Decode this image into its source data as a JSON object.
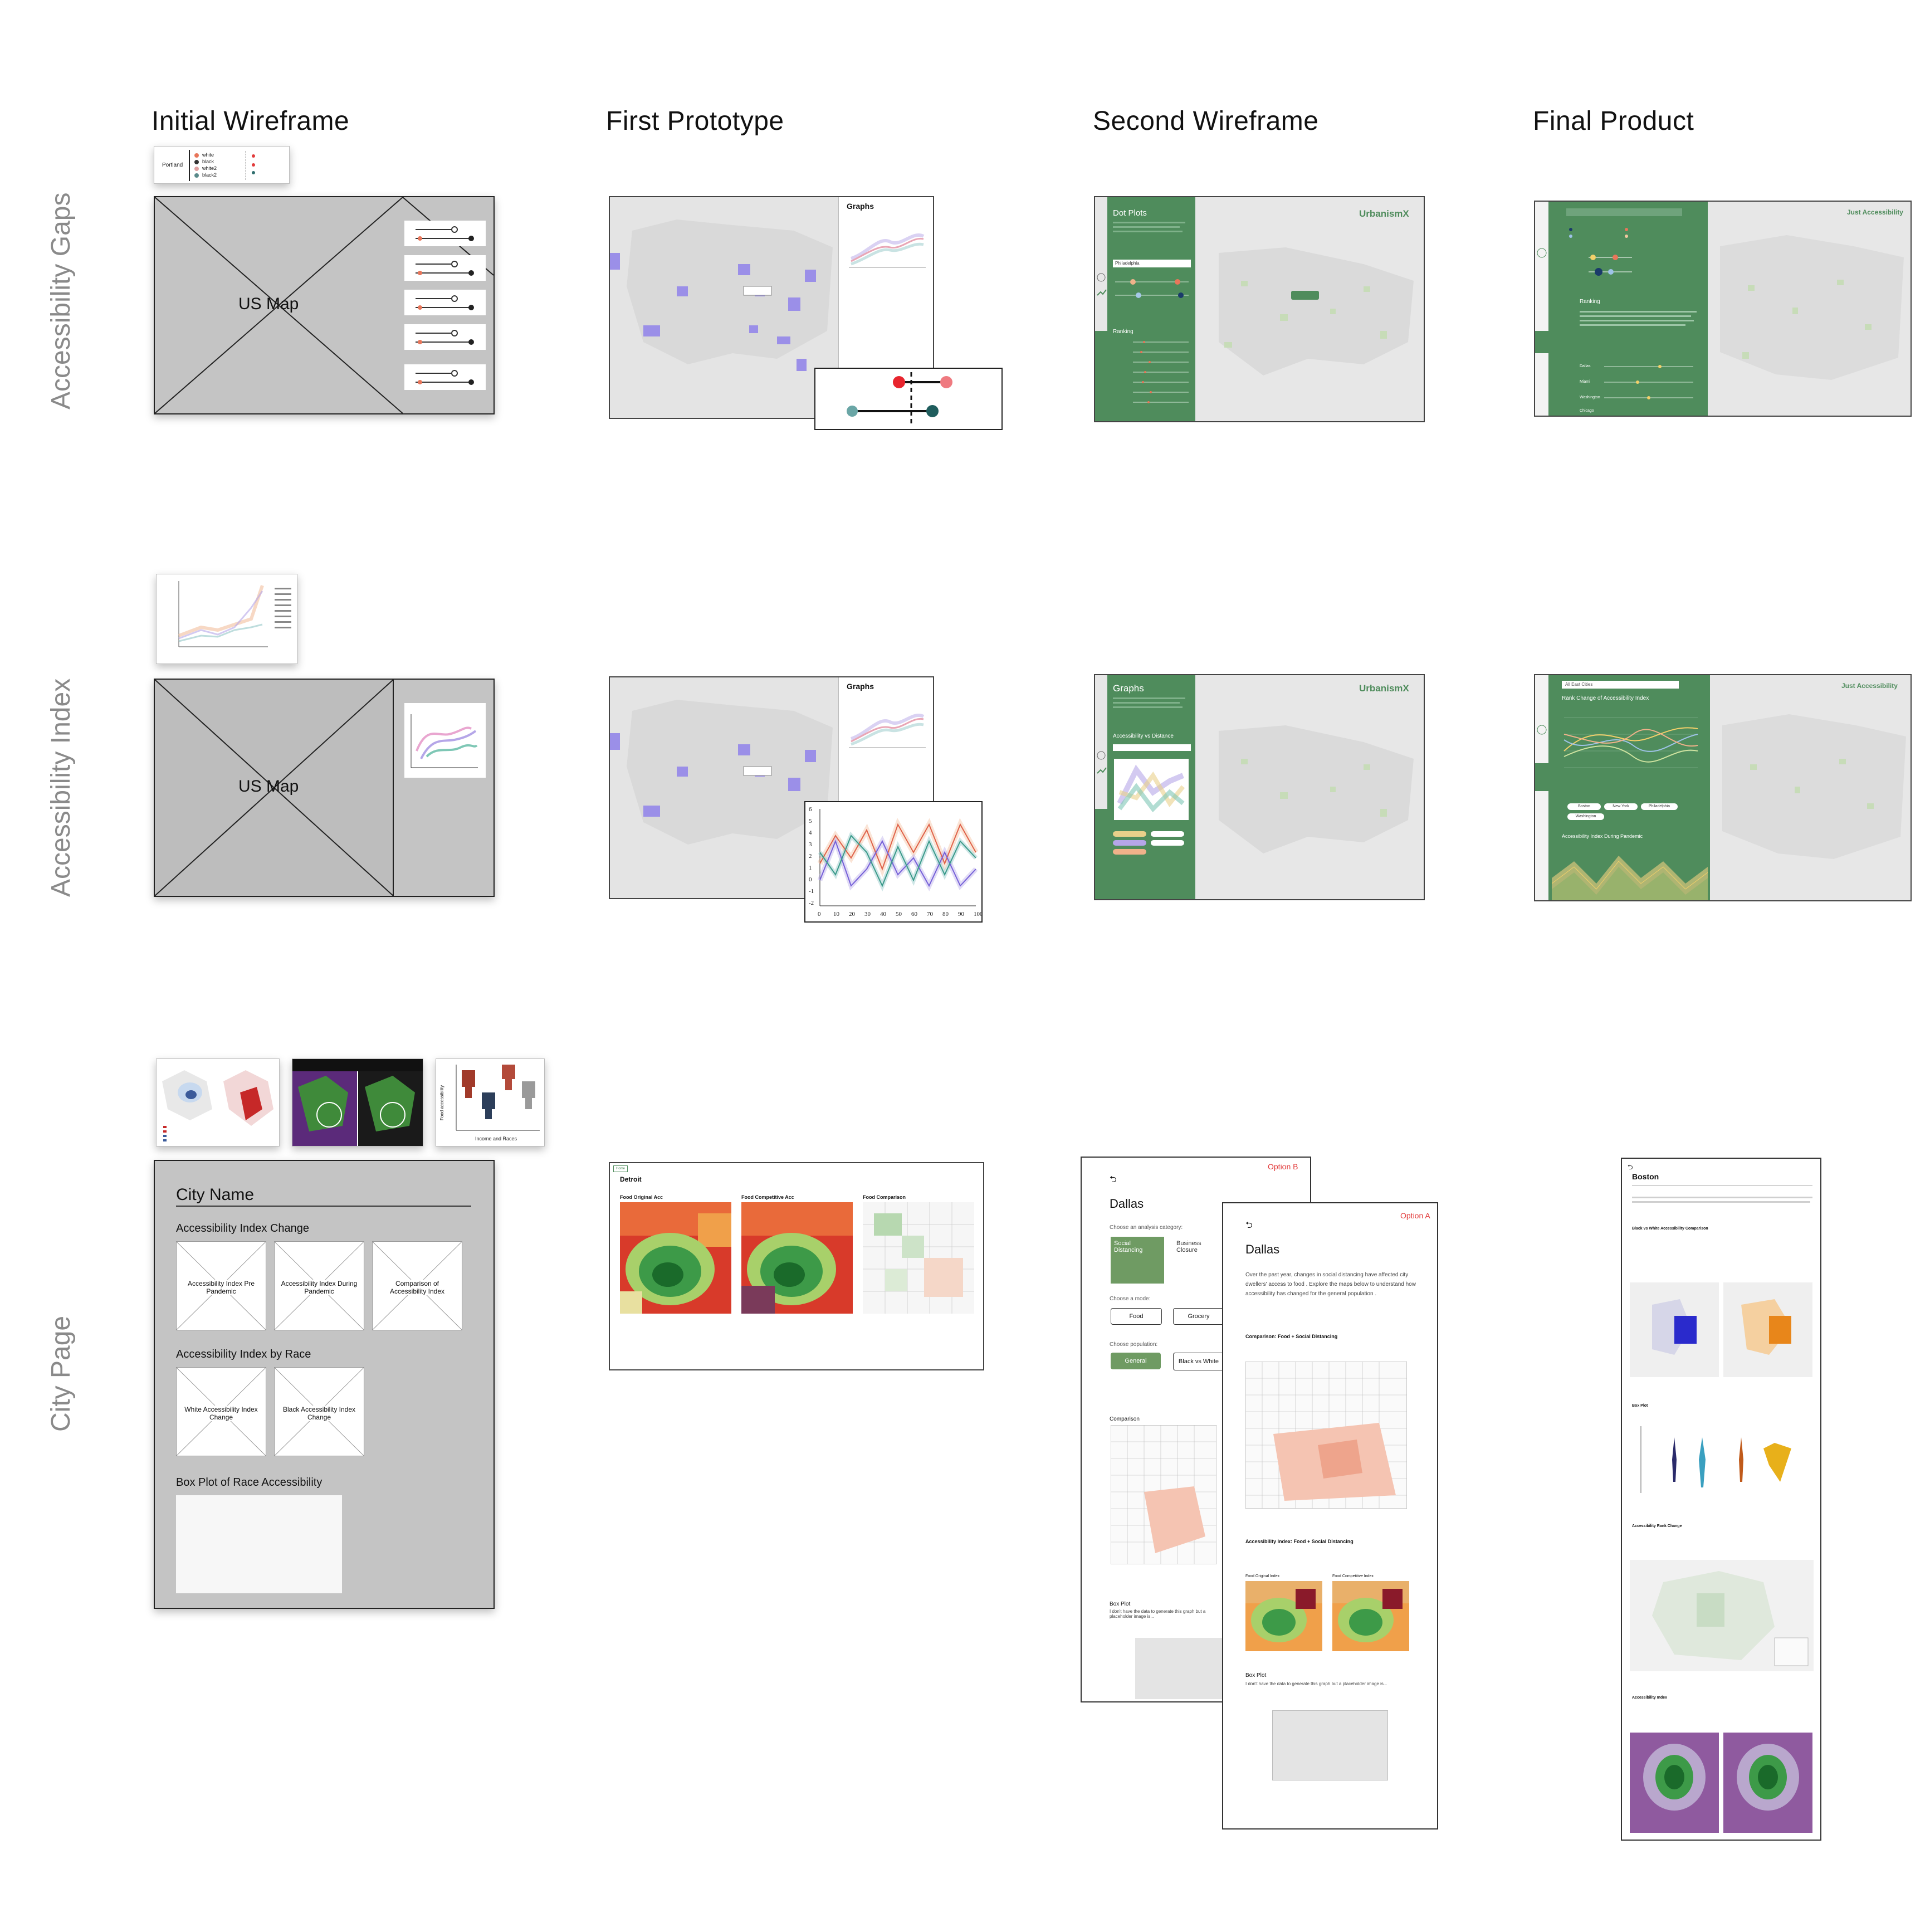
{
  "columns": [
    "Initial Wireframe",
    "First Prototype",
    "Second Wireframe",
    "Final Product"
  ],
  "rows": [
    "Accessibility Gaps",
    "Accessibility Index",
    "City Page"
  ],
  "colors": {
    "green_panel": "#4f8c5c",
    "wire_gray": "#c4c4c4",
    "accent_red": "#e23b3b",
    "accent_teal": "#2f6e6e",
    "map_gray": "#e7e7e7"
  },
  "gaps": {
    "wireframe": {
      "map_label": "US Map",
      "legend_city": "Portland",
      "legend_items": [
        "white",
        "black",
        "white2",
        "black2"
      ]
    },
    "prototype": {
      "panel_title": "Graphs"
    },
    "second": {
      "panel_title": "Dot Plots",
      "brand": "UrbanismX",
      "city_select": "Philadelphia",
      "ranking_label": "Ranking"
    },
    "final": {
      "brand": "Just Accessibility",
      "ranking_label": "Ranking",
      "cities": [
        "Dallas",
        "Miami",
        "Washington",
        "Chicago"
      ]
    }
  },
  "index": {
    "wireframe": {
      "map_label": "US Map"
    },
    "prototype": {
      "panel_title": "Graphs",
      "x_ticks": [
        "0",
        "10",
        "20",
        "30",
        "40",
        "50",
        "60",
        "70",
        "80",
        "90",
        "100"
      ],
      "y_ticks": [
        "6",
        "5",
        "4",
        "3",
        "2",
        "1",
        "0",
        "-1",
        "-2"
      ]
    },
    "second": {
      "panel_title": "Graphs",
      "brand": "UrbanismX",
      "chart_label": "Accessibility vs Distance"
    },
    "final": {
      "brand": "Just Accessibility",
      "select": "All East Cities",
      "chart_title": "Rank Change of Accessibility Index",
      "chart2_title": "Accessibility Index During Pandemic",
      "legend": [
        "Boston",
        "New York",
        "Philadelphia",
        "Washington"
      ]
    }
  },
  "city": {
    "wireframe": {
      "title": "City Name",
      "section1": "Accessibility Index Change",
      "cards1": [
        "Accessibility Index Pre Pandemic",
        "Accessibility Index During Pandemic",
        "Comparison of Accessibility Index"
      ],
      "section2": "Accessibility Index by Race",
      "cards2": [
        "White Accessibility Index Change",
        "Black Accessibility Index Change"
      ],
      "section3": "Box Plot of Race Accessibility",
      "thumb_x_label": "Income and Races",
      "thumb_y_label": "Food accessibility"
    },
    "prototype": {
      "tag": "Home",
      "city": "Detroit",
      "maps": [
        "Food Original Acc",
        "Food Competitive Acc",
        "Food Comparison"
      ]
    },
    "second": {
      "optionB": {
        "label": "Option B",
        "city": "Dallas",
        "prompt1": "Choose an analysis category:",
        "cat1": "Social Distancing",
        "cat2": "Business Closure",
        "prompt2": "Choose a mode:",
        "mode1": "Food",
        "mode2": "Grocery",
        "prompt3": "Choose population:",
        "pop1": "General",
        "pop2": "Black vs White",
        "comparison": "Comparison",
        "boxplot": "Box Plot",
        "boxnote": "I don't have the data to generate this graph but a placeholder image is..."
      },
      "optionA": {
        "label": "Option A",
        "city": "Dallas",
        "intro": "Over the past year, changes in social distancing have affected city dwellers' access to food . Explore the maps below to understand how accessibility has changed for the general population .",
        "comparison": "Comparison: Food + Social Distancing",
        "index_title": "Accessibility Index: Food + Social Distancing",
        "map1": "Food Original Index",
        "map2": "Food Competitive Index",
        "boxplot": "Box Plot",
        "boxnote": "I don't have the data to generate this graph but a placeholder image is..."
      }
    },
    "final": {
      "city": "Boston",
      "s1": "Black vs White Accessibility Comparison",
      "s2": "Box Plot",
      "s3": "Accessibility Rank Change",
      "s4": "Accessibility Index"
    }
  }
}
